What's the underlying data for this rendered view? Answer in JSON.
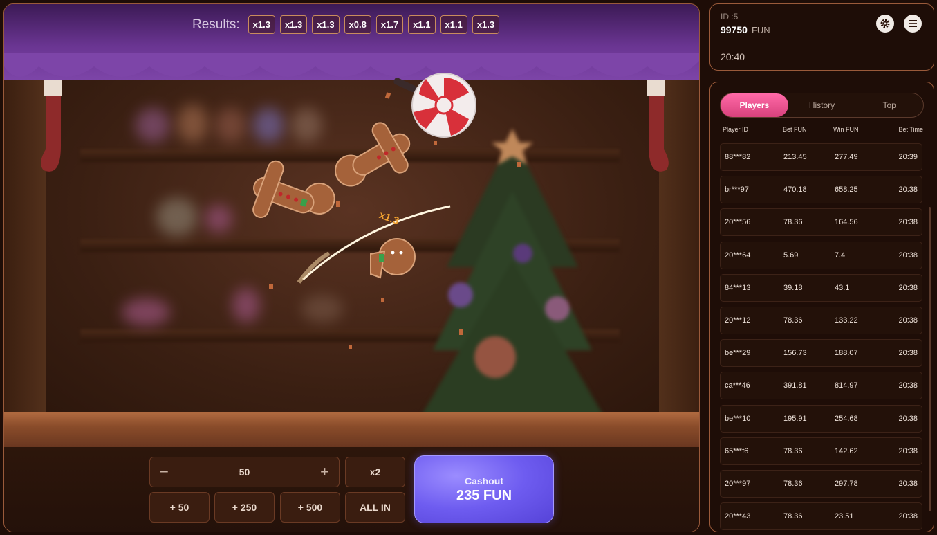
{
  "game": {
    "results_label": "Results:",
    "results": [
      "x1.3",
      "x1.3",
      "x1.3",
      "x0.8",
      "x1.7",
      "x1.1",
      "x1.1",
      "x1.3"
    ],
    "floating_multiplier": "x1.3"
  },
  "controls": {
    "minus": "−",
    "plus": "+",
    "amount": "50",
    "double_label": "x2",
    "quick": [
      "+ 50",
      "+ 250",
      "+ 500"
    ],
    "all_in_label": "ALL IN",
    "cashout_label": "Cashout",
    "cashout_amount": "235  FUN"
  },
  "info": {
    "id": "ID :5",
    "balance": "99750",
    "currency": "FUN",
    "time": "20:40",
    "settings_icon": "gear-icon",
    "menu_icon": "menu-icon"
  },
  "players": {
    "tabs": [
      "Players",
      "History",
      "Top"
    ],
    "active_tab": "Players",
    "headers": [
      "Player ID",
      "Bet  FUN",
      "Win  FUN",
      "Bet Time"
    ],
    "rows": [
      {
        "id": "88***82",
        "bet": "213.45",
        "win": "277.49",
        "time": "20:39"
      },
      {
        "id": "br***97",
        "bet": "470.18",
        "win": "658.25",
        "time": "20:38"
      },
      {
        "id": "20***56",
        "bet": "78.36",
        "win": "164.56",
        "time": "20:38"
      },
      {
        "id": "20***64",
        "bet": "5.69",
        "win": "7.4",
        "time": "20:38"
      },
      {
        "id": "84***13",
        "bet": "39.18",
        "win": "43.1",
        "time": "20:38"
      },
      {
        "id": "20***12",
        "bet": "78.36",
        "win": "133.22",
        "time": "20:38"
      },
      {
        "id": "be***29",
        "bet": "156.73",
        "win": "188.07",
        "time": "20:38"
      },
      {
        "id": "ca***46",
        "bet": "391.81",
        "win": "814.97",
        "time": "20:38"
      },
      {
        "id": "be***10",
        "bet": "195.91",
        "win": "254.68",
        "time": "20:38"
      },
      {
        "id": "65***f6",
        "bet": "78.36",
        "win": "142.62",
        "time": "20:38"
      },
      {
        "id": "20***97",
        "bet": "78.36",
        "win": "297.78",
        "time": "20:38"
      },
      {
        "id": "20***43",
        "bet": "78.36",
        "win": "23.51",
        "time": "20:38"
      }
    ]
  },
  "colors": {
    "accent_pink": "#e24f8a",
    "cashout_purple": "#6e5cf0",
    "border_copper": "#9a5a3a",
    "curtain_purple": "#6a3592"
  }
}
